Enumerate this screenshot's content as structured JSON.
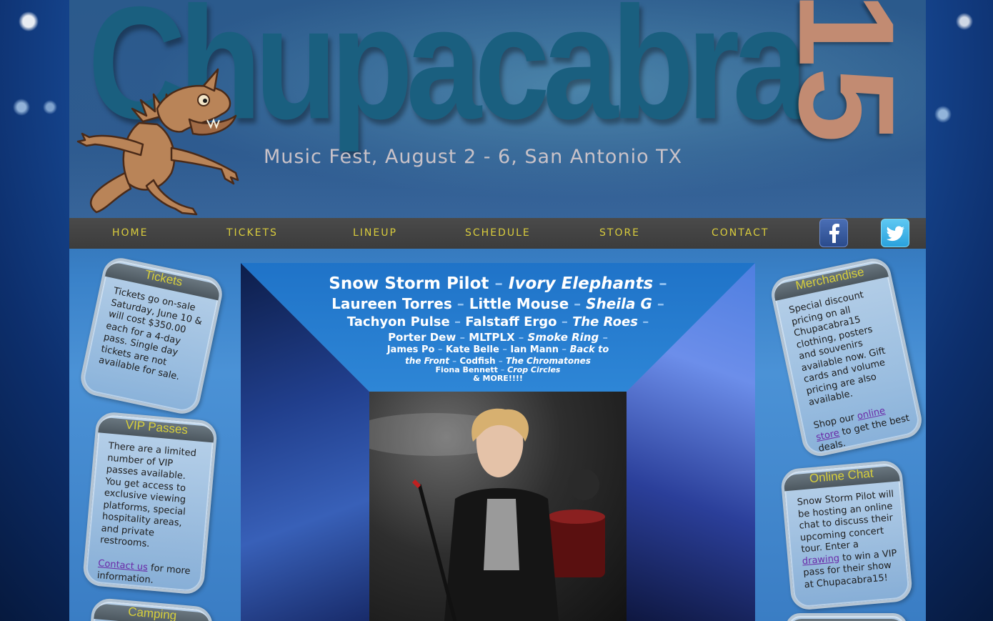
{
  "header": {
    "logo_word": "Chupacabra",
    "logo_number": "15",
    "tagline": "Music Fest, August 2 - 6, San Antonio TX"
  },
  "nav": {
    "items": [
      "HOME",
      "TICKETS",
      "LINEUP",
      "SCHEDULE",
      "STORE",
      "CONTACT"
    ],
    "social": [
      "facebook-icon",
      "twitter-icon"
    ]
  },
  "colors": {
    "nav_text": "#d9cc3d",
    "logo_word": "#1a5f7f",
    "logo_number": "#c28b72",
    "box_title": "#d7cf3b",
    "link": "#6a2aa8"
  },
  "boxes": {
    "tickets": {
      "title": "Tickets",
      "text": "Tickets go on-sale Saturday, June 10 & will cost $350.00 each for a 4-day pass. Single day tickets are not available for sale."
    },
    "vip": {
      "title": "VIP Passes",
      "text": "There are a limited number of VIP passes available. You get access to exclusive viewing platforms, special hospitality areas, and private restrooms.",
      "link": "Contact us",
      "text_after": "for more information."
    },
    "camping": {
      "title": "Camping"
    },
    "merch": {
      "title": "Merchandise",
      "text": "Special discount pricing on all Chupacabra15 clothing, posters and souvenirs available now. Gift cards and volume pricing are also available.",
      "text_before": "Shop our",
      "link": "online store",
      "text_after": "to get the best deals."
    },
    "chat": {
      "title": "Online Chat",
      "text": "Snow Storm Pilot will be hosting an online chat to discuss their upcoming concert tour. Enter a",
      "link": "drawing",
      "text_after": "to win a VIP pass for their show at Chupacabra15!"
    }
  },
  "lineup": {
    "row1": [
      "Snow Storm Pilot",
      "Ivory Elephants"
    ],
    "row2": [
      "Laureen Torres",
      "Little Mouse",
      "Sheila G"
    ],
    "row3": [
      "Tachyon Pulse",
      "Falstaff Ergo",
      "The Roes"
    ],
    "row4": [
      "Porter Dew",
      "MLTPLX",
      "Smoke Ring"
    ],
    "row5": [
      "James Po",
      "Kate Belle",
      "Ian Mann",
      "Back to"
    ],
    "row6": [
      "the Front",
      "Codfish",
      "The Chromatones"
    ],
    "row7": [
      "Fiona Bennett",
      "Crop Circles"
    ],
    "more": "& MORE!!!!",
    "separator": "–"
  }
}
